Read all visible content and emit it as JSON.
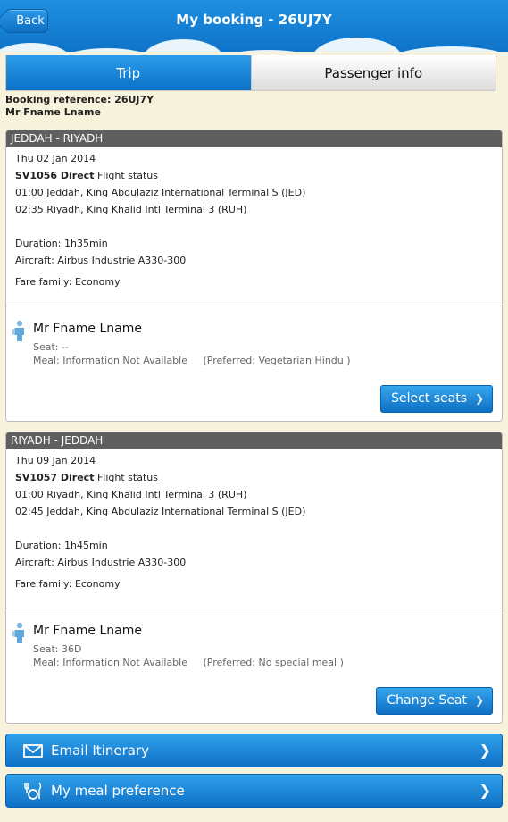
{
  "header": {
    "back_label": "Back",
    "title": "My booking - 26UJ7Y"
  },
  "tabs": [
    {
      "label": "Trip",
      "active": true
    },
    {
      "label": "Passenger info",
      "active": false
    }
  ],
  "booking": {
    "reference_line": "Booking reference: 26UJ7Y",
    "passenger_name": "Mr Fname Lname"
  },
  "segments": [
    {
      "route": "JEDDAH - RIYADH",
      "date": "Thu 02 Jan 2014",
      "flight": "SV1056 Direct",
      "flight_status_link": "Flight status",
      "departure": "01:00 Jeddah, King Abdulaziz International Terminal S (JED)",
      "arrival": "02:35 Riyadh, King Khalid Intl Terminal 3 (RUH)",
      "duration": "Duration: 1h35min",
      "aircraft": "Aircraft: Airbus Industrie A330-300",
      "fare_family": "Fare family: Economy",
      "passenger": {
        "name": "Mr Fname Lname",
        "seat": "Seat: --",
        "meal": "Meal: Information Not Available",
        "preferred": "(Preferred: Vegetarian Hindu )",
        "button_label": "Select seats"
      }
    },
    {
      "route": "RIYADH - JEDDAH",
      "date": "Thu 09 Jan 2014",
      "flight": "SV1057 Direct",
      "flight_status_link": "Flight status",
      "departure": "01:00 Riyadh, King Khalid Intl Terminal 3 (RUH)",
      "arrival": "02:45 Jeddah, King Abdulaziz International Terminal S (JED)",
      "duration": "Duration: 1h45min",
      "aircraft": "Aircraft: Airbus Industrie A330-300",
      "fare_family": "Fare family: Economy",
      "passenger": {
        "name": "Mr Fname Lname",
        "seat": "Seat: 36D",
        "meal": "Meal: Information Not Available",
        "preferred": "(Preferred: No special meal )",
        "button_label": "Change Seat"
      }
    }
  ],
  "actions": {
    "email_label": "Email Itinerary",
    "email_icon": "envelope-icon",
    "meal_label": "My meal preference",
    "meal_icon": "meal-icon"
  },
  "colors": {
    "brand_blue": "#0e74c9",
    "segment_header": "#5f5f5f",
    "page_background": "#f7f2dc"
  }
}
